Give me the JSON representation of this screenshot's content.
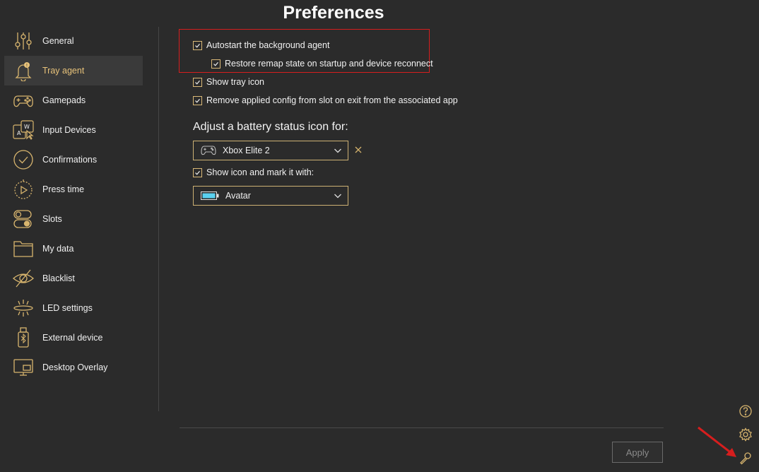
{
  "title": "Preferences",
  "sidebar": {
    "items": [
      {
        "label": "General",
        "icon": "sliders-icon"
      },
      {
        "label": "Tray agent",
        "icon": "bell-icon",
        "active": true
      },
      {
        "label": "Gamepads",
        "icon": "gamepad-icon"
      },
      {
        "label": "Input Devices",
        "icon": "keyboard-mouse-icon"
      },
      {
        "label": "Confirmations",
        "icon": "check-circle-icon"
      },
      {
        "label": "Press time",
        "icon": "timer-icon"
      },
      {
        "label": "Slots",
        "icon": "toggle-icon"
      },
      {
        "label": "My data",
        "icon": "folder-icon"
      },
      {
        "label": "Blacklist",
        "icon": "eye-off-icon"
      },
      {
        "label": "LED settings",
        "icon": "led-icon"
      },
      {
        "label": "External device",
        "icon": "usb-device-icon"
      },
      {
        "label": "Desktop Overlay",
        "icon": "monitor-icon"
      }
    ]
  },
  "main": {
    "autostart_label": "Autostart the background agent",
    "autostart_checked": true,
    "restore_label": "Restore remap state on startup and device reconnect",
    "restore_checked": true,
    "tray_icon_label": "Show tray icon",
    "tray_icon_checked": true,
    "remove_config_label": "Remove applied config from slot on exit from the associated app",
    "remove_config_checked": true,
    "battery_section_label": "Adjust a battery status icon for:",
    "device_select_value": "Xbox Elite 2",
    "show_icon_label": "Show icon and mark it with:",
    "show_icon_checked": true,
    "mark_select_value": "Avatar"
  },
  "footer": {
    "apply_label": "Apply"
  },
  "corner_icons": [
    "help-icon",
    "settings-gear-icon",
    "wrench-icon"
  ],
  "colors": {
    "background": "#2b2b2b",
    "accent": "#e7c27a",
    "highlight_border": "#d61e1e",
    "battery_fill": "#5ad1f0"
  }
}
